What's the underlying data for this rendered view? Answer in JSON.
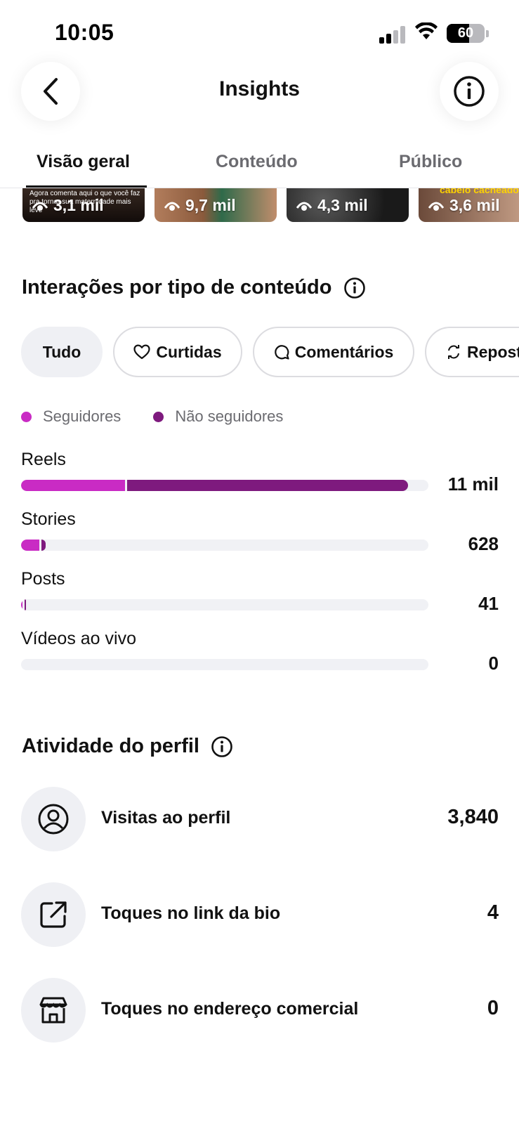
{
  "status_bar": {
    "time": "10:05",
    "battery": "60"
  },
  "header": {
    "title": "Insights",
    "back_icon": "chevron-left-icon",
    "info_icon": "info-icon"
  },
  "tabs": [
    {
      "label": "Visão geral",
      "active": true
    },
    {
      "label": "Conteúdo",
      "active": false
    },
    {
      "label": "Público",
      "active": false
    }
  ],
  "thumbnails": [
    {
      "views": "3,1 mil",
      "caption": "Agora comenta aqui o que você faz pra tornar sua maternidade mais leve"
    },
    {
      "views": "9,7 mil"
    },
    {
      "views": "4,3 mil"
    },
    {
      "views": "3,6 mil",
      "caption": "cabelo cacheado?"
    }
  ],
  "interactions": {
    "title": "Interações por tipo de conteúdo",
    "chips": [
      {
        "label": "Tudo",
        "icon": "",
        "active": true
      },
      {
        "label": "Curtidas",
        "icon": "heart-icon",
        "active": false
      },
      {
        "label": "Comentários",
        "icon": "comment-icon",
        "active": false
      },
      {
        "label": "Reposts",
        "icon": "repost-icon",
        "active": false
      }
    ],
    "legend": [
      {
        "label": "Seguidores",
        "color": "#c92bc4"
      },
      {
        "label": "Não seguidores",
        "color": "#7e1a7e"
      }
    ],
    "rows": [
      {
        "label": "Reels",
        "value": "11 mil",
        "followers_fraction": 0.255,
        "nonfollowers_fraction": 0.69
      },
      {
        "label": "Stories",
        "value": "628",
        "followers_fraction": 0.045,
        "nonfollowers_fraction": 0.01
      },
      {
        "label": "Posts",
        "value": "41",
        "followers_fraction": 0.004,
        "nonfollowers_fraction": 0.002
      },
      {
        "label": "Vídeos ao vivo",
        "value": "0",
        "followers_fraction": 0,
        "nonfollowers_fraction": 0
      }
    ]
  },
  "profile_activity": {
    "title": "Atividade do perfil",
    "rows": [
      {
        "label": "Visitas ao perfil",
        "value": "3,840",
        "icon": "person-circle-icon"
      },
      {
        "label": "Toques no link da bio",
        "value": "4",
        "icon": "external-link-icon"
      },
      {
        "label": "Toques no endereço comercial",
        "value": "0",
        "icon": "storefront-icon"
      }
    ]
  },
  "colors": {
    "followers": "#c92bc4",
    "nonfollowers": "#7e1a7e",
    "track": "#f0f1f5"
  }
}
